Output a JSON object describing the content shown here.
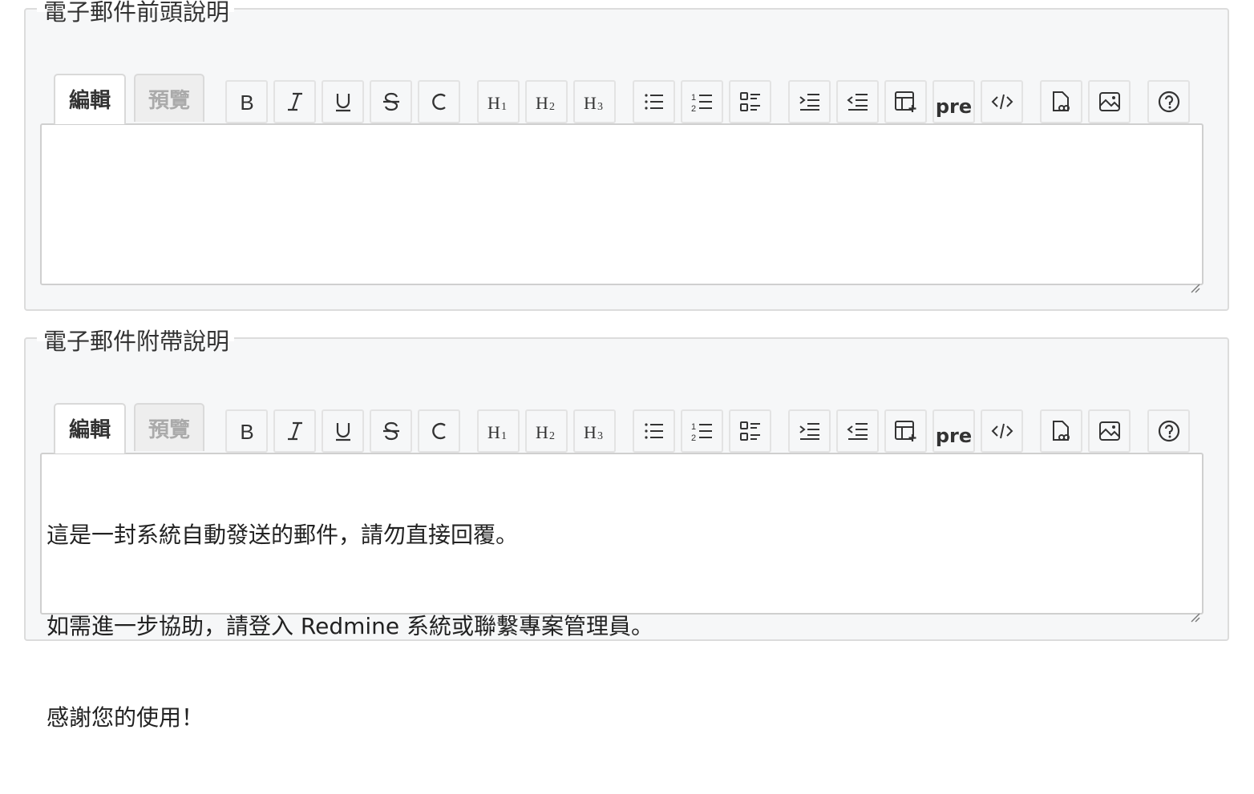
{
  "header_section": {
    "legend": "電子郵件前頭說明",
    "tabs": {
      "edit": "編輯",
      "preview": "預覽"
    },
    "text": ""
  },
  "footer_section": {
    "legend": "電子郵件附帶說明",
    "tabs": {
      "edit": "編輯",
      "preview": "預覽"
    },
    "lines": [
      "這是一封系統自動發送的郵件，請勿直接回覆。",
      "如需進一步協助，請登入 Redmine 系統或聯繫專案管理員。",
      "感謝您的使用！"
    ]
  },
  "toolbar": {
    "buttons": [
      {
        "name": "bold",
        "icon": "bold-icon"
      },
      {
        "name": "italic",
        "icon": "italic-icon"
      },
      {
        "name": "underline",
        "icon": "underline-icon"
      },
      {
        "name": "strikethrough",
        "icon": "strikethrough-icon"
      },
      {
        "name": "inline-code",
        "icon": "code-c-icon"
      },
      {
        "name": "heading-1",
        "icon": "h1-icon"
      },
      {
        "name": "heading-2",
        "icon": "h2-icon"
      },
      {
        "name": "heading-3",
        "icon": "h3-icon"
      },
      {
        "name": "unordered-list",
        "icon": "list-icon"
      },
      {
        "name": "ordered-list",
        "icon": "ordered-list-icon"
      },
      {
        "name": "task-list",
        "icon": "task-list-icon"
      },
      {
        "name": "indent",
        "icon": "indent-icon"
      },
      {
        "name": "outdent",
        "icon": "outdent-icon"
      },
      {
        "name": "table",
        "icon": "table-plus-icon"
      },
      {
        "name": "pre",
        "icon": "pre-icon"
      },
      {
        "name": "code-block",
        "icon": "code-icon"
      },
      {
        "name": "wiki-link",
        "icon": "file-link-icon"
      },
      {
        "name": "image",
        "icon": "image-icon"
      },
      {
        "name": "help",
        "icon": "help-icon"
      }
    ],
    "pre_label": "pre"
  }
}
